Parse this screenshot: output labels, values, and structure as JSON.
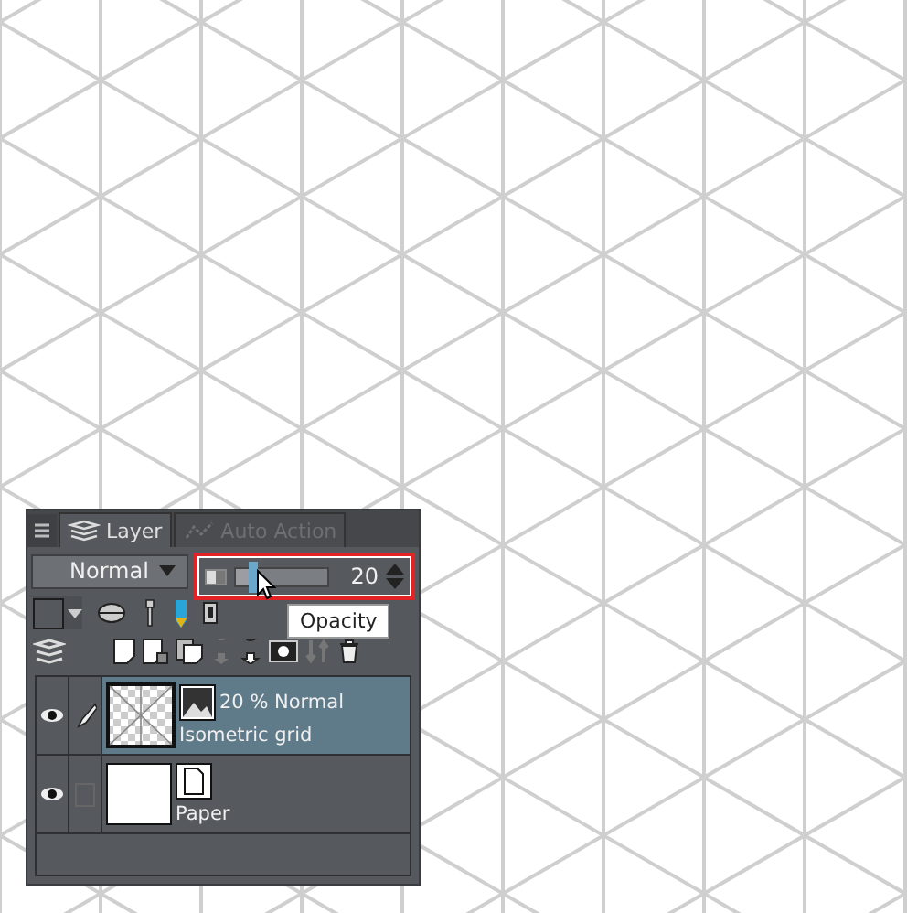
{
  "tabs": [
    {
      "label": "Layer",
      "selected": true
    },
    {
      "label": "Auto Action",
      "selected": false
    }
  ],
  "blend_mode": {
    "value": "Normal"
  },
  "opacity": {
    "level": 0.2,
    "reading": "20",
    "highlighted": true
  },
  "tooltip": "Opacity",
  "layers": [
    {
      "kind": "raster",
      "info": "20 % Normal",
      "name": "Isometric grid",
      "selected": true,
      "visible": true,
      "editing": true
    },
    {
      "kind": "paper",
      "name": "Paper",
      "selected": false,
      "visible": true,
      "editing": false
    }
  ]
}
